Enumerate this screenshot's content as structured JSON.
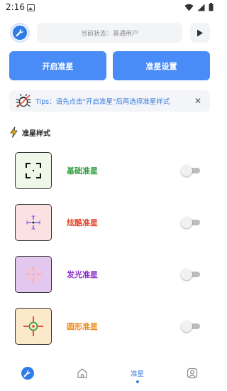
{
  "status_bar": {
    "time": "2:16",
    "icons": [
      "image-icon",
      "wifi-icon",
      "signal-icon",
      "battery-icon"
    ]
  },
  "header": {
    "app_icon": "wrench-icon",
    "status_text": "当前状态：普通用户",
    "play_icon": "play-icon"
  },
  "actions": {
    "start_label": "开启准星",
    "settings_label": "准星设置",
    "accent_color": "#4a8cf7"
  },
  "tips": {
    "icon": "bug-icon",
    "text": "Tips：请先点击\"开启准星\"后再选择准星样式",
    "close_icon": "close-icon"
  },
  "section": {
    "icon": "lightning-icon",
    "title": "准星样式"
  },
  "styles": [
    {
      "label": "基础准星",
      "color": "#2e9e3c",
      "thumb_bg": "#eef7e8",
      "enabled": false
    },
    {
      "label": "炫酷准星",
      "color": "#e5462b",
      "thumb_bg": "#fbe1e1",
      "enabled": false
    },
    {
      "label": "发光准星",
      "color": "#8b2fc9",
      "thumb_bg": "#e4c7ef",
      "enabled": false
    },
    {
      "label": "圆形准星",
      "color": "#ef8b1c",
      "thumb_bg": "#fce9c9",
      "enabled": false
    }
  ],
  "bottom_nav": {
    "items": [
      {
        "icon": "wrench-icon",
        "label": ""
      },
      {
        "icon": "home-icon",
        "label": ""
      },
      {
        "icon": "",
        "label": "准星",
        "active": true
      },
      {
        "icon": "user-icon",
        "label": ""
      }
    ]
  }
}
